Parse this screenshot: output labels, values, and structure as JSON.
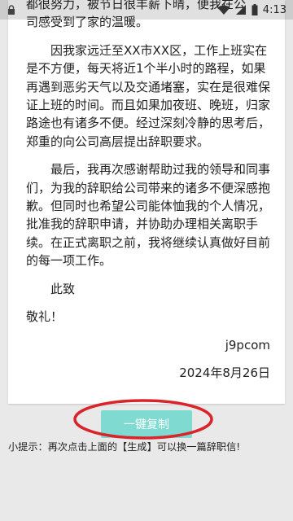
{
  "status_bar": {
    "time": "4:13",
    "icons": [
      "lock-icon",
      "wifi-icon",
      "signal-icon",
      "battery-icon"
    ]
  },
  "letter": {
    "top_fragment_1": "都很努力，被节日很丰薪下晴，便我在公",
    "top_fragment_2": "司感受到了家的温暖。",
    "paragraph_1": "因我家远迁至XX市XX区，工作上班实在是不方便，每天将近1个半小时的路程，如果再遇到恶劣天气以及交通堵塞，实在是很难保证上班的时间。而且如果加夜班、晚班，归家路途也有诸多不便。经过深刻冷静的思考后，郑重的向公司高层提出辞职要求。",
    "paragraph_2": "最后，我再次感谢帮助过我的领导和同事们，为我的辞职给公司带来的诸多不便深感抱歉。但同时也希望公司能体恤我的个人情况，批准我的辞职申请，并协助办理相关离职手续。在正式离职之前，我将继续认真做好目前的每一项工作。",
    "closing_1": "此致",
    "closing_2": "敬礼！",
    "signature": "j9pcom",
    "date": "2024年8月26日"
  },
  "copy_button_label": "一键复制",
  "tip_text": "小提示：再次点击上面的【生成】可以换一篇辞职信!",
  "colors": {
    "button": "#7fdbd2",
    "highlight_circle": "#d8242a",
    "background": "#e9e9e9"
  }
}
